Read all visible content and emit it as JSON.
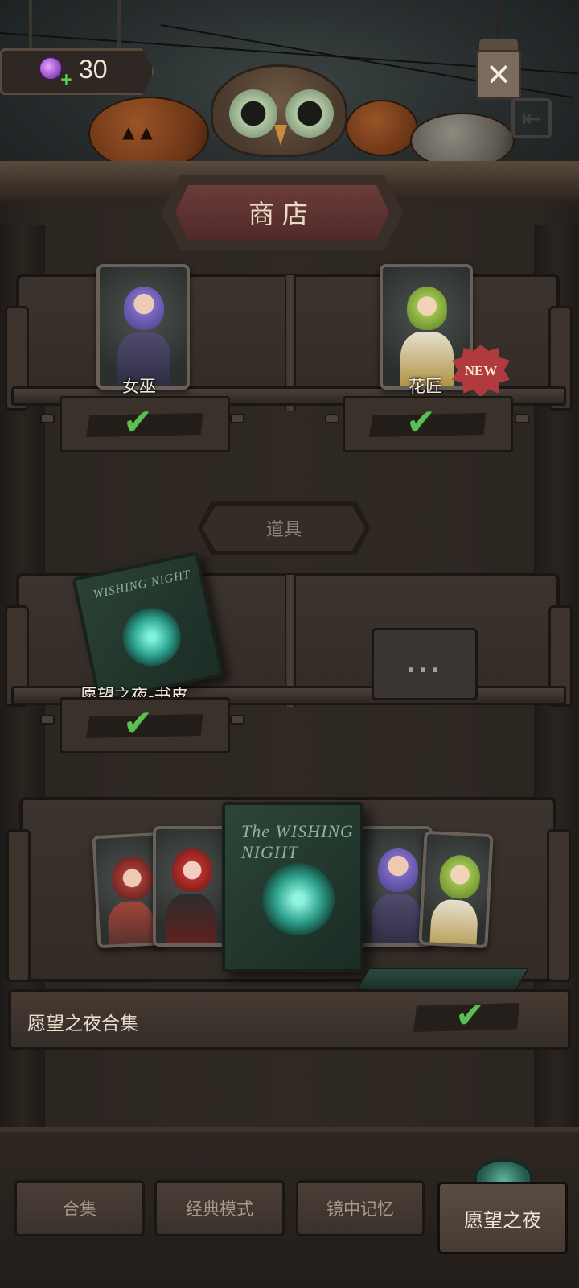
{
  "currency": {
    "value": "30",
    "icon": "candy-icon"
  },
  "header": {
    "title": "商店",
    "close_icon": "close-icon",
    "exit_icon": "exit-icon"
  },
  "characters": [
    {
      "name": "女巫",
      "owned": true,
      "is_new": false
    },
    {
      "name": "花匠",
      "owned": true,
      "is_new": true,
      "badge": "NEW"
    }
  ],
  "items_section": {
    "label": "道具"
  },
  "items": [
    {
      "name": "愿望之夜-书皮",
      "owned": true
    },
    {
      "name": "...",
      "placeholder": true
    }
  ],
  "book_art": {
    "title_small": "WISHING NIGHT",
    "title_big": "The WISHING NIGHT"
  },
  "bundle": {
    "name": "愿望之夜合集",
    "owned": true
  },
  "tabs": [
    {
      "label": "合集",
      "active": false
    },
    {
      "label": "经典模式",
      "active": false
    },
    {
      "label": "镜中记忆",
      "active": false
    },
    {
      "label": "愿望之夜",
      "active": true
    }
  ],
  "colors": {
    "check": "#5bbf55",
    "new_badge": "#b03a3e",
    "title_plaque": "#6b3c3a"
  }
}
